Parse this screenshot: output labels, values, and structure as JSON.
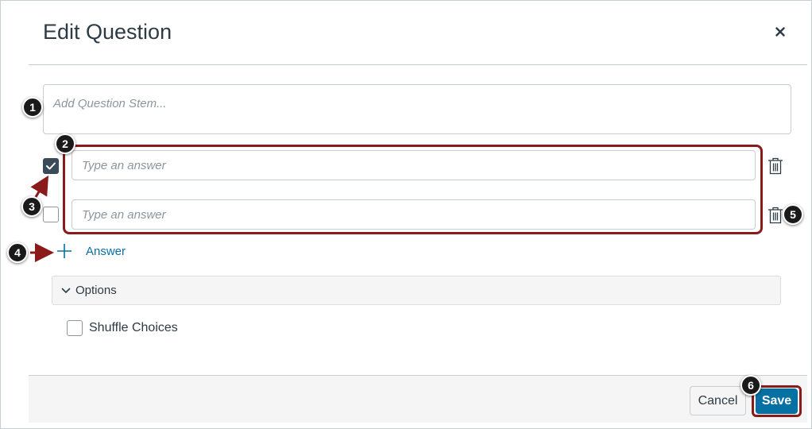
{
  "modal": {
    "title": "Edit Question",
    "close_icon": "close-icon"
  },
  "question_stem": {
    "placeholder": "Add Question Stem..."
  },
  "answers": [
    {
      "placeholder": "Type an answer",
      "correct": true
    },
    {
      "placeholder": "Type an answer",
      "correct": false
    }
  ],
  "add_answer": {
    "label": "Answer",
    "icon": "plus-icon"
  },
  "options": {
    "label": "Options",
    "icon": "chevron-down-icon",
    "shuffle_label": "Shuffle Choices",
    "shuffle_checked": false
  },
  "footer": {
    "cancel_label": "Cancel",
    "save_label": "Save"
  },
  "callouts": [
    "1",
    "2",
    "3",
    "4",
    "5",
    "6"
  ],
  "colors": {
    "accent": "#0770a3",
    "highlight": "#8b1a1a",
    "callout_bg": "#1a1a1a",
    "checked_box": "#394b58"
  }
}
